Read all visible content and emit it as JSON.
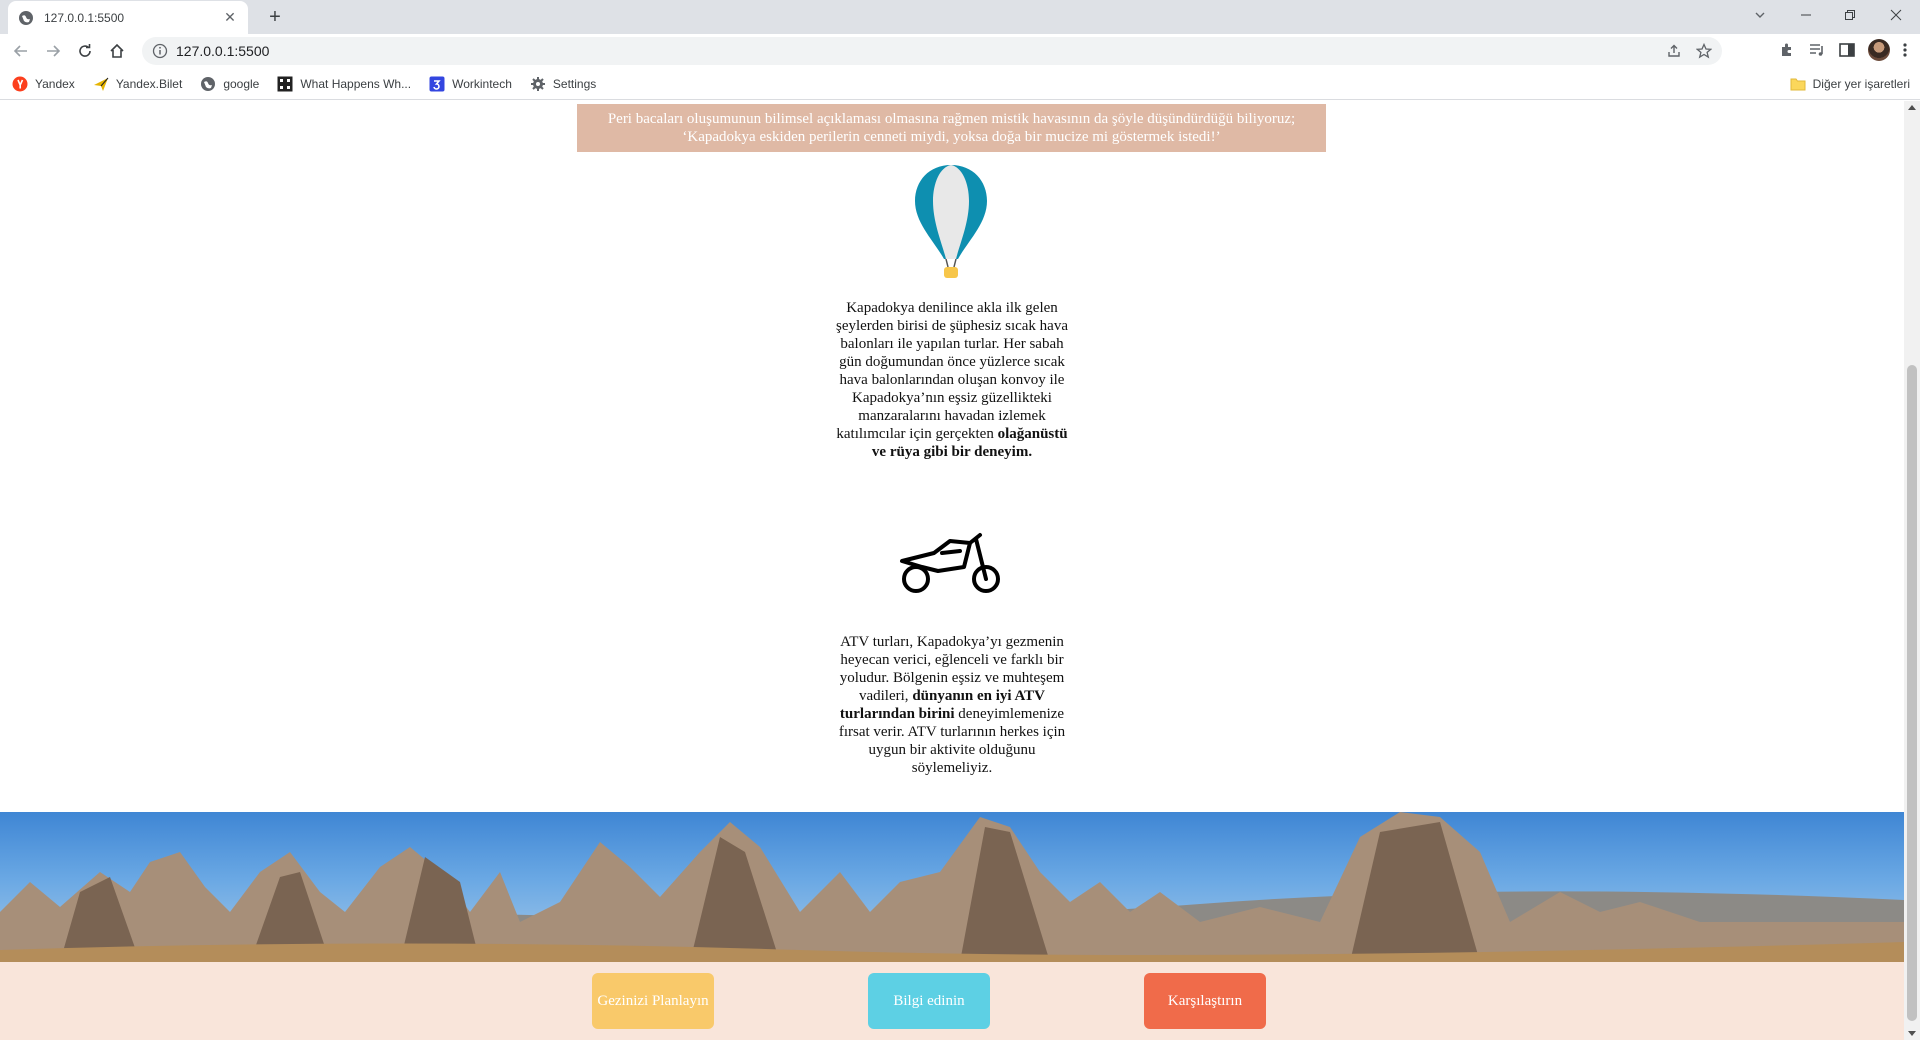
{
  "browser": {
    "tab_title": "127.0.0.1:5500",
    "url": "127.0.0.1:5500",
    "bookmarks": [
      {
        "label": "Yandex",
        "icon": "yandex-icon"
      },
      {
        "label": "Yandex.Bilet",
        "icon": "plane-icon"
      },
      {
        "label": "google",
        "icon": "globe-icon"
      },
      {
        "label": "What Happens Wh...",
        "icon": "grid-icon"
      },
      {
        "label": "Workintech",
        "icon": "workintech-icon"
      },
      {
        "label": "Settings",
        "icon": "gear-icon"
      }
    ],
    "other_bookmarks": "Diğer yer işaretleri"
  },
  "page": {
    "quote_line1": "Peri bacaları oluşumunun bilimsel açıklaması olmasına rağmen mistik havasının da şöyle düşündürdüğü biliyoruz;",
    "quote_line2": "‘Kapadokya eskiden perilerin cenneti miydi, yoksa doğa bir mucize mi göstermek istedi!’",
    "balloon_text": "Kapadokya denilince akla ilk gelen şeylerden birisi de şüphesiz sıcak hava balonları ile yapılan turlar. Her sabah gün doğumundan önce yüzlerce sıcak hava balonlarından oluşan konvoy ile Kapadokya’nın eşsiz güzellikteki manzaralarını havadan izlemek katılımcılar için gerçekten",
    "balloon_bold": "olağanüstü ve rüya gibi bir deneyim.",
    "atv_text_before": "ATV turları, Kapadokya’yı gezmenin heyecan verici, eğlenceli ve farklı bir yoludur. Bölgenin eşsiz ve muhteşem vadileri,",
    "atv_bold": "dünyanın en iyi ATV turlarından birini",
    "atv_text_after": "deneyimlemenize fırsat verir. ATV turlarının herkes için uygun bir aktivite olduğunu söylemeliyiz.",
    "buttons": {
      "plan": "Gezinizi Planlayın",
      "info": "Bilgi edinin",
      "compare": "Karşılaştırın"
    }
  },
  "colors": {
    "quote_bg": "#dfb9a5",
    "footer_bg": "#f9e5da",
    "btn_plan": "#f9c96a",
    "btn_info": "#5dd0e4",
    "btn_compare": "#f06b4a"
  }
}
